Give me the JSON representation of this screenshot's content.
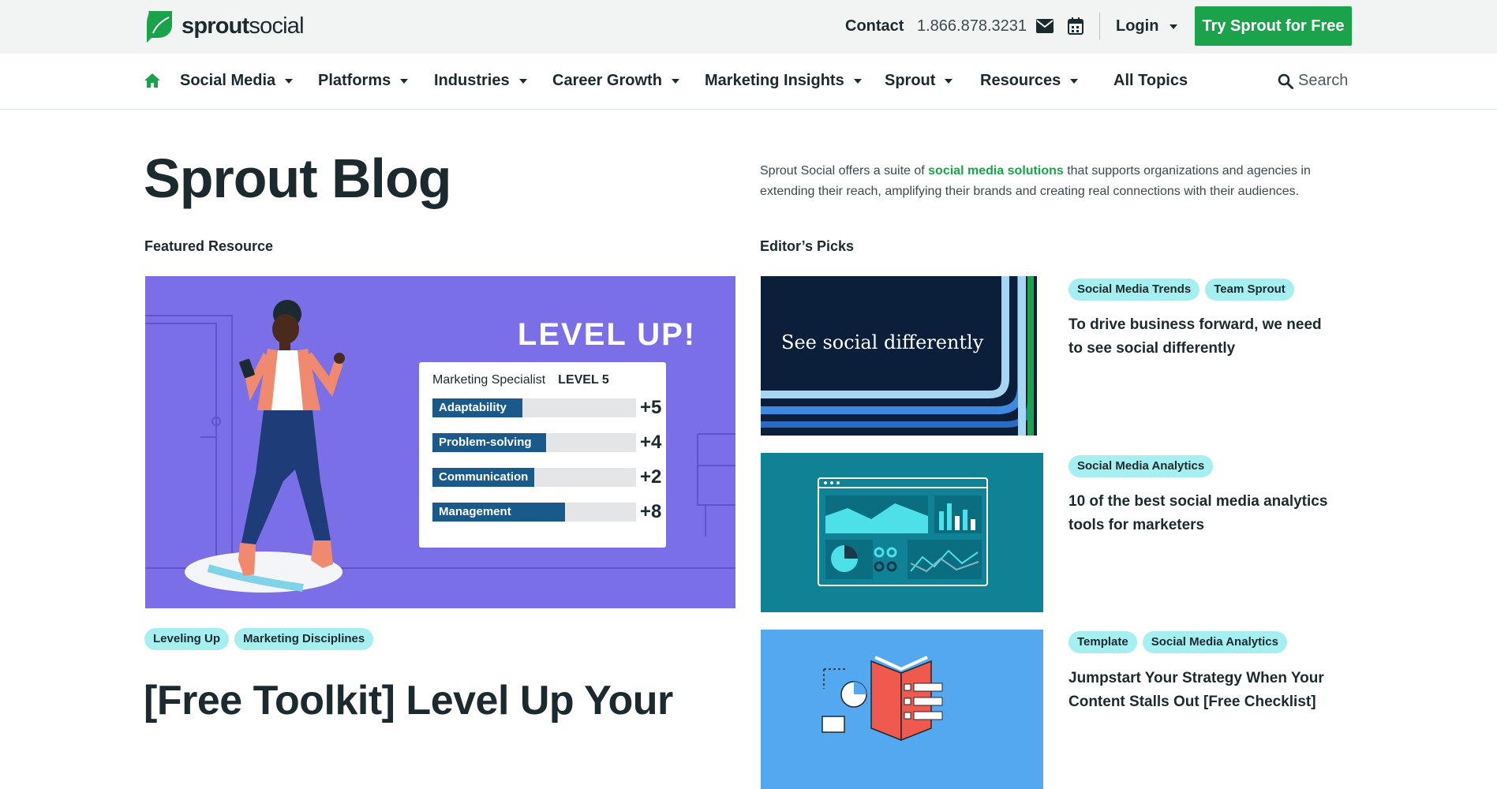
{
  "brand": {
    "name_bold": "sprout",
    "name_light": "social",
    "accent": "#1aa34a",
    "tag_color": "#a6eff0"
  },
  "utility": {
    "contact": "Contact",
    "phone": "1.866.878.3231",
    "mail_icon": "envelope-icon",
    "calendar_icon": "calendar-icon",
    "login": "Login",
    "cta": "Try Sprout for Free"
  },
  "nav": {
    "home_icon": "home-icon",
    "items": [
      {
        "label": "Social Media"
      },
      {
        "label": "Platforms"
      },
      {
        "label": "Industries"
      },
      {
        "label": "Career Growth"
      },
      {
        "label": "Marketing Insights"
      },
      {
        "label": "Sprout"
      },
      {
        "label": "Resources"
      },
      {
        "label": "All Topics"
      }
    ],
    "search": "Search"
  },
  "hero": {
    "title": "Sprout Blog",
    "intro_before": "Sprout Social offers a suite of ",
    "intro_link": "social media solutions",
    "intro_after": " that supports organizations and agencies in extending their reach, amplifying their brands and creating real connections with their audiences."
  },
  "featured": {
    "label": "Featured Resource",
    "image": {
      "headline": "LEVEL UP!",
      "card_role": "Marketing Specialist",
      "card_level": "LEVEL 5",
      "skills": [
        {
          "name": "Adaptability",
          "score": "+5",
          "fill": 0.44
        },
        {
          "name": "Problem-solving",
          "score": "+4",
          "fill": 0.56
        },
        {
          "name": "Communication",
          "score": "+2",
          "fill": 0.5
        },
        {
          "name": "Management",
          "score": "+8",
          "fill": 0.65
        }
      ]
    },
    "tags": [
      "Leveling Up",
      "Marketing Disciplines"
    ],
    "title": "[Free Toolkit] Level Up Your"
  },
  "editors_picks": {
    "label": "Editor’s Picks",
    "items": [
      {
        "image_text": "See social differently",
        "tags": [
          "Social Media Trends",
          "Team Sprout"
        ],
        "title": "To drive business forward, we need to see social differently"
      },
      {
        "image_text": "",
        "tags": [
          "Social Media Analytics"
        ],
        "title": "10 of the best social media analytics tools for marketers"
      },
      {
        "image_text": "",
        "tags": [
          "Template",
          "Social Media Analytics"
        ],
        "title": "Jumpstart Your Strategy When Your Content Stalls Out [Free Checklist]"
      }
    ]
  }
}
